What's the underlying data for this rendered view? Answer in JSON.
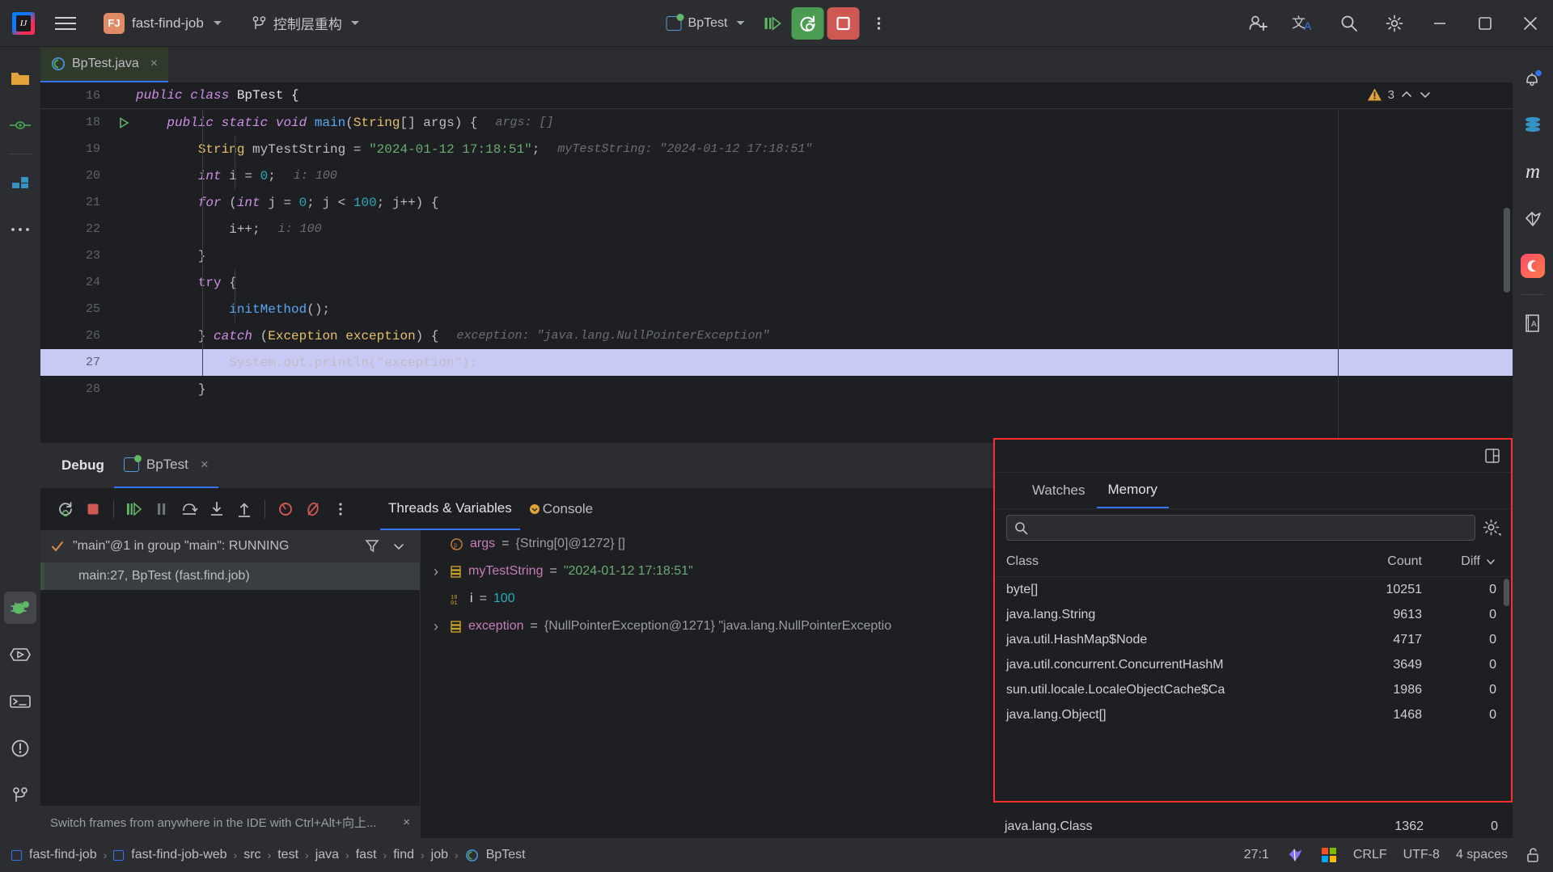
{
  "titlebar": {
    "menu_icon": "hamburger-icon",
    "project_badge": "FJ",
    "project_name": "fast-find-job",
    "branch_name": "控制层重构",
    "run_config": "BpTest",
    "buttons": {
      "resume": "resume-program-icon",
      "rerun_debug": "rerun-debug-button",
      "stop": "stop-button",
      "more": "more-options-icon",
      "share": "add-collaborator-icon",
      "translate": "translate-icon",
      "search": "search-everywhere-icon",
      "settings": "settings-icon",
      "minimize": "minimize-button",
      "maximize": "maximize-button",
      "close": "close-button"
    }
  },
  "leftbar": {
    "items": [
      {
        "name": "project-tool-window",
        "icon": "folder-icon"
      },
      {
        "name": "commit-tool-window",
        "icon": "commit-icon"
      },
      {
        "name": "structure-tool-window",
        "icon": "structure-icon"
      },
      {
        "name": "more-tool-windows",
        "icon": "more-dots-icon"
      },
      {
        "name": "debug-tool-window",
        "icon": "debug-bug-icon"
      },
      {
        "name": "run-tool-window",
        "icon": "run-icon"
      },
      {
        "name": "terminal-tool-window",
        "icon": "terminal-icon"
      },
      {
        "name": "problems-tool-window",
        "icon": "problems-icon"
      },
      {
        "name": "git-tool-window",
        "icon": "git-branch-icon"
      }
    ]
  },
  "rightbar": {
    "items": [
      {
        "name": "notifications",
        "icon": "bell-icon"
      },
      {
        "name": "database",
        "icon": "database-icon"
      },
      {
        "name": "maven",
        "icon": "maven-m-icon"
      },
      {
        "name": "translation-plugin",
        "icon": "translation-bird-icon"
      },
      {
        "name": "ai-assistant",
        "icon": "ai-moon-icon"
      },
      {
        "name": "dictionary",
        "icon": "book-a-icon"
      }
    ]
  },
  "editor": {
    "tab": {
      "label": "BpTest.java",
      "icon": "java-class-icon",
      "close": "×"
    },
    "sticky_line": {
      "number": "16",
      "code": "public class BpTest {"
    },
    "warnings": {
      "count": "3",
      "icon": "warning-triangle-icon"
    },
    "lines": [
      {
        "number": "18",
        "gutter": "run-gutter-icon",
        "indent": 1,
        "tokens": [
          {
            "t": "public ",
            "c": "kw"
          },
          {
            "t": "static ",
            "c": "kw"
          },
          {
            "t": "void ",
            "c": "kw"
          },
          {
            "t": "main",
            "c": "meth"
          },
          {
            "t": "(",
            "c": "plain"
          },
          {
            "t": "String",
            "c": "type"
          },
          {
            "t": "[] args) {",
            "c": "plain"
          }
        ],
        "hint": "args: []"
      },
      {
        "number": "19",
        "gutter": "",
        "indent": 2,
        "tokens": [
          {
            "t": "String ",
            "c": "type"
          },
          {
            "t": "myTestString ",
            "c": "plain"
          },
          {
            "t": "= ",
            "c": "plain"
          },
          {
            "t": "\"2024-01-12 17:18:51\"",
            "c": "str"
          },
          {
            "t": ";",
            "c": "plain"
          }
        ],
        "hint": "myTestString: \"2024-01-12 17:18:51\""
      },
      {
        "number": "20",
        "gutter": "",
        "indent": 2,
        "tokens": [
          {
            "t": "int ",
            "c": "kw"
          },
          {
            "t": "i = ",
            "c": "plain"
          },
          {
            "t": "0",
            "c": "num"
          },
          {
            "t": ";",
            "c": "plain"
          }
        ],
        "hint": "i: 100"
      },
      {
        "number": "21",
        "gutter": "",
        "indent": 2,
        "tokens": [
          {
            "t": "for ",
            "c": "kw"
          },
          {
            "t": "(",
            "c": "plain"
          },
          {
            "t": "int ",
            "c": "kw"
          },
          {
            "t": "j = ",
            "c": "plain"
          },
          {
            "t": "0",
            "c": "num"
          },
          {
            "t": "; j < ",
            "c": "plain"
          },
          {
            "t": "100",
            "c": "num"
          },
          {
            "t": "; j++) {",
            "c": "plain"
          }
        ],
        "hint": ""
      },
      {
        "number": "22",
        "gutter": "",
        "indent": 3,
        "tokens": [
          {
            "t": "i++;",
            "c": "plain"
          }
        ],
        "hint": "i: 100"
      },
      {
        "number": "23",
        "gutter": "",
        "indent": 2,
        "tokens": [
          {
            "t": "}",
            "c": "plain"
          }
        ],
        "hint": ""
      },
      {
        "number": "24",
        "gutter": "",
        "indent": 2,
        "tokens": [
          {
            "t": "try ",
            "c": "kw2"
          },
          {
            "t": "{",
            "c": "plain"
          }
        ],
        "hint": ""
      },
      {
        "number": "25",
        "gutter": "",
        "indent": 3,
        "tokens": [
          {
            "t": "initMethod",
            "c": "meth"
          },
          {
            "t": "();",
            "c": "plain"
          }
        ],
        "hint": ""
      },
      {
        "number": "26",
        "gutter": "",
        "indent": 2,
        "tokens": [
          {
            "t": "} ",
            "c": "plain"
          },
          {
            "t": "catch ",
            "c": "kw"
          },
          {
            "t": "(",
            "c": "plain"
          },
          {
            "t": "Exception ",
            "c": "type"
          },
          {
            "t": "exception",
            "c": "type"
          },
          {
            "t": ") {",
            "c": "plain"
          }
        ],
        "hint": "exception: \"java.lang.NullPointerException\""
      },
      {
        "number": "27",
        "gutter": "",
        "indent": 3,
        "highlight": true,
        "tokens": [
          {
            "t": "System.out.println(\"exception\");",
            "c": "plain"
          }
        ],
        "hint": ""
      },
      {
        "number": "28",
        "gutter": "",
        "indent": 2,
        "tokens": [
          {
            "t": "}",
            "c": "plain"
          }
        ],
        "hint": ""
      }
    ]
  },
  "debug": {
    "title": "Debug",
    "session_tab": "BpTest",
    "session_close": "×",
    "header_more": "more-options-icon",
    "header_minimize": "minimize-icon",
    "toolbar": [
      {
        "name": "restart-debug-button",
        "icon": "rerun-debug-icon"
      },
      {
        "name": "stop-button",
        "icon": "stop-square-icon"
      },
      {
        "name": "resume-program-button",
        "icon": "resume-icon"
      },
      {
        "name": "pause-program-button",
        "icon": "pause-icon"
      },
      {
        "name": "step-over-button",
        "icon": "step-over-icon"
      },
      {
        "name": "step-into-button",
        "icon": "step-into-icon"
      },
      {
        "name": "step-out-button",
        "icon": "step-out-icon"
      },
      {
        "name": "view-breakpoints-button",
        "icon": "breakpoint-icon"
      },
      {
        "name": "mute-breakpoints-button",
        "icon": "mute-breakpoint-icon"
      },
      {
        "name": "more-debug-options",
        "icon": "more-dots-icon"
      }
    ],
    "tabs": [
      {
        "label": "Threads & Variables",
        "active": true
      },
      {
        "label": "Console",
        "active": false,
        "icon": "console-icon"
      }
    ],
    "thread": {
      "status_icon": "check-icon",
      "label": "\"main\"@1 in group \"main\": RUNNING",
      "filter_icon": "filter-icon",
      "chevron_icon": "chevron-down-icon"
    },
    "frame": "main:27, BpTest (fast.find.job)",
    "hint_bar": {
      "text": "Switch frames from anywhere in the IDE with Ctrl+Alt+向上...",
      "close": "×"
    },
    "variables": [
      {
        "expandable": false,
        "icon": "parameter-icon",
        "name": "args",
        "eq": " = ",
        "value": "{String[0]@1272} []",
        "value_class": "vval"
      },
      {
        "expandable": true,
        "icon": "field-icon",
        "name": "myTestString",
        "eq": " = ",
        "value": "\"2024-01-12 17:18:51\"",
        "value_class": "vstr"
      },
      {
        "expandable": false,
        "icon": "primitive-icon",
        "name": "i",
        "eq": " = ",
        "value": "100",
        "value_class": "vnum"
      },
      {
        "expandable": true,
        "icon": "field-icon",
        "name": "exception",
        "eq": " = ",
        "value": "{NullPointerException@1271} \"java.lang.NullPointerExceptio",
        "value_class": "vval"
      }
    ]
  },
  "memory": {
    "highlight_color": "#ff2e2e",
    "layout_icon": "layout-split-icon",
    "tabs": [
      {
        "label": "Watches",
        "active": false
      },
      {
        "label": "Memory",
        "active": true
      }
    ],
    "search": {
      "placeholder": "",
      "value": "",
      "icon": "search-icon"
    },
    "settings_icon": "gear-icon",
    "columns": [
      "Class",
      "Count",
      "Diff"
    ],
    "sort_icon": "chevron-down-icon",
    "rows": [
      {
        "class": "byte[]",
        "count": "10251",
        "diff": "0"
      },
      {
        "class": "java.lang.String",
        "count": "9613",
        "diff": "0"
      },
      {
        "class": "java.util.HashMap$Node",
        "count": "4717",
        "diff": "0"
      },
      {
        "class": "java.util.concurrent.ConcurrentHashM",
        "count": "3649",
        "diff": "0"
      },
      {
        "class": "sun.util.locale.LocaleObjectCache$Ca",
        "count": "1986",
        "diff": "0"
      },
      {
        "class": "java.lang.Object[]",
        "count": "1468",
        "diff": "0"
      },
      {
        "class": "java.lang.Class",
        "count": "1362",
        "diff": "0"
      }
    ]
  },
  "statusbar": {
    "breadcrumbs": [
      {
        "label": "fast-find-job",
        "icon": "module-icon"
      },
      {
        "label": "fast-find-job-web",
        "icon": "module-icon"
      },
      {
        "label": "src",
        "icon": ""
      },
      {
        "label": "test",
        "icon": ""
      },
      {
        "label": "java",
        "icon": ""
      },
      {
        "label": "fast",
        "icon": ""
      },
      {
        "label": "find",
        "icon": ""
      },
      {
        "label": "job",
        "icon": ""
      },
      {
        "label": "BpTest",
        "icon": "java-class-icon"
      }
    ],
    "separator": "›",
    "position": "27:1",
    "translate_icon": "translation-bird-icon",
    "windows_icon": "windows-logo-icon",
    "line_separator": "CRLF",
    "encoding": "UTF-8",
    "indent": "4 spaces",
    "lock_icon": "unlocked-icon"
  }
}
